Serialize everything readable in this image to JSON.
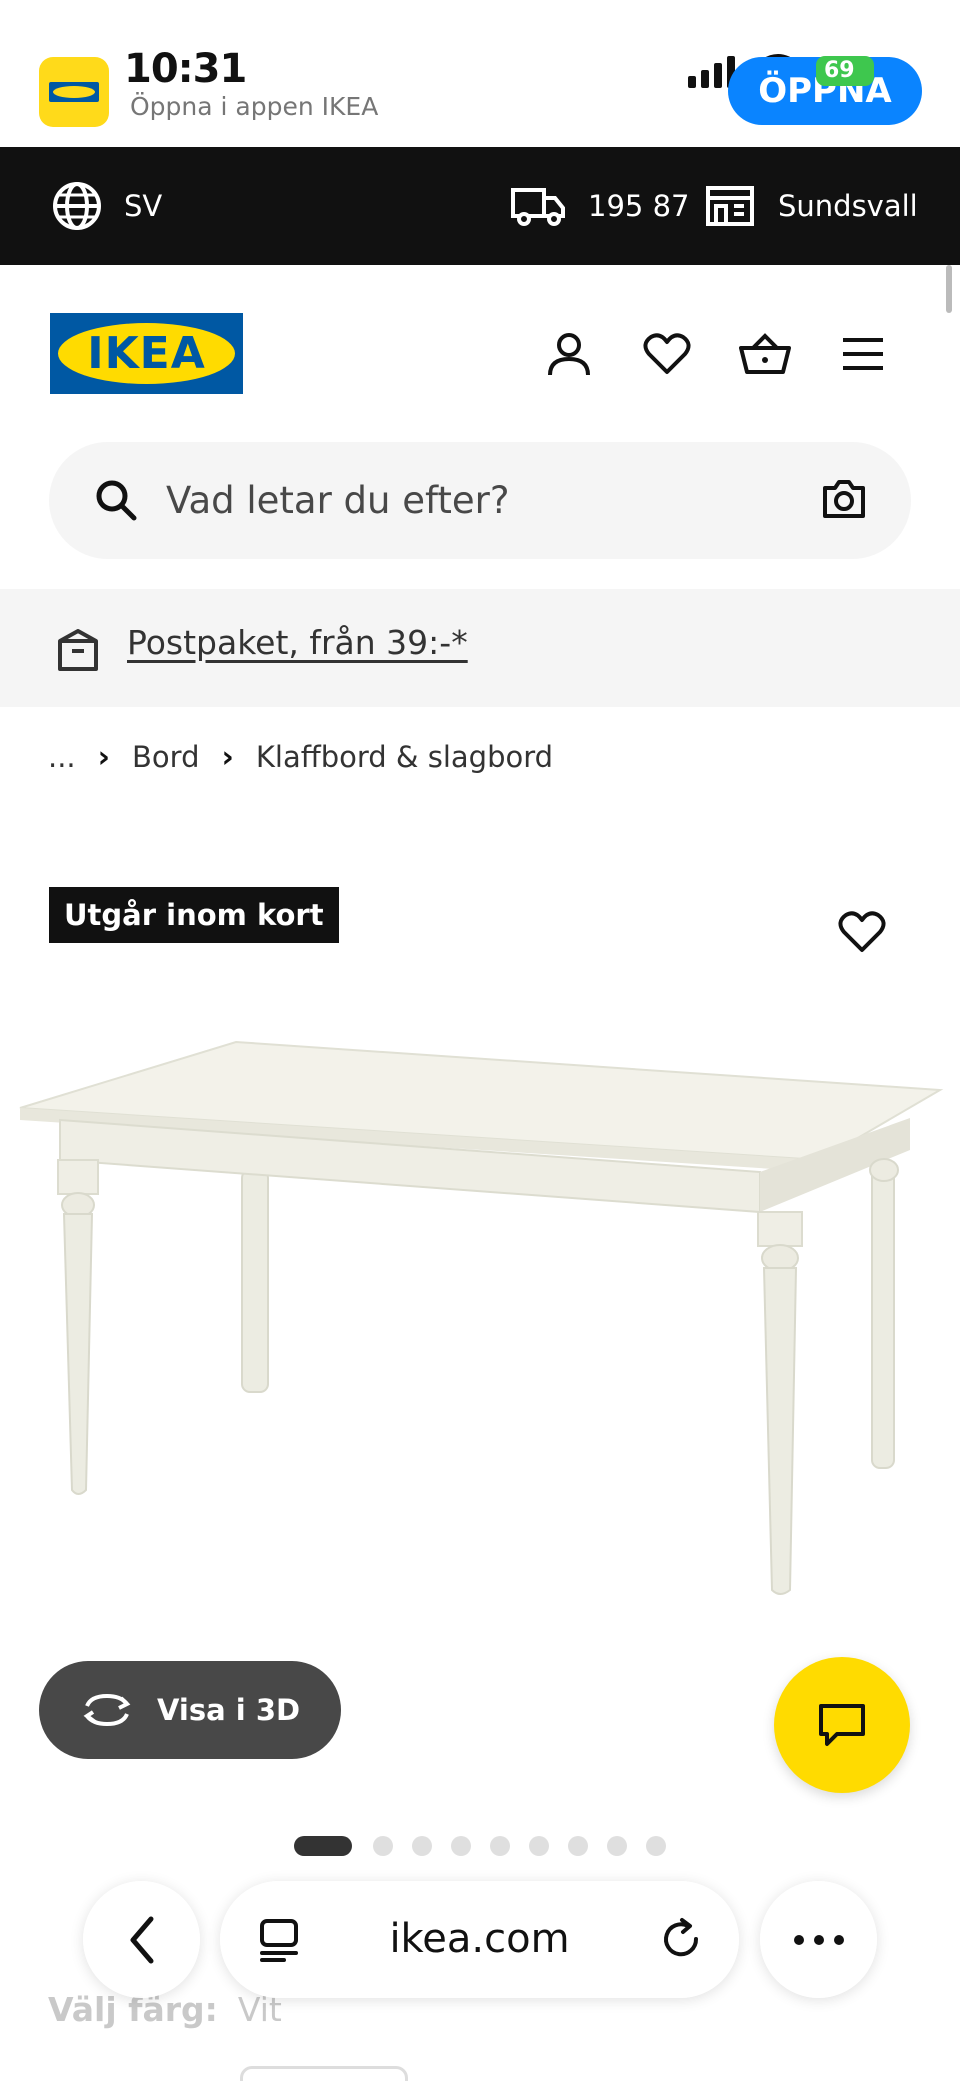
{
  "status_bar": {
    "time": "10:31",
    "battery": "69"
  },
  "app_banner": {
    "subtitle": "Öppna i appen IKEA",
    "open_label": "ÖPPNA"
  },
  "location_bar": {
    "language": "SV",
    "postcode": "195 87",
    "store": "Sundsvall"
  },
  "header": {
    "logo_text": "IKEA"
  },
  "search": {
    "placeholder": "Vad letar du efter?"
  },
  "shipping": {
    "link_text": "Postpaket, från 39:-*"
  },
  "breadcrumb": {
    "ellipsis": "...",
    "items": [
      "Bord",
      "Klaffbord & slagbord"
    ]
  },
  "product": {
    "badge": "Utgår inom kort",
    "view3d_label": "Visa i 3D"
  },
  "carousel": {
    "count": 9,
    "active_index": 0
  },
  "color_picker": {
    "label": "Välj färg:",
    "value": "Vit"
  },
  "safari": {
    "domain": "ikea.com"
  },
  "colors": {
    "ikea_blue": "#0058a3",
    "ikea_yellow": "#ffdb00",
    "open_blue": "#0a84ff"
  }
}
